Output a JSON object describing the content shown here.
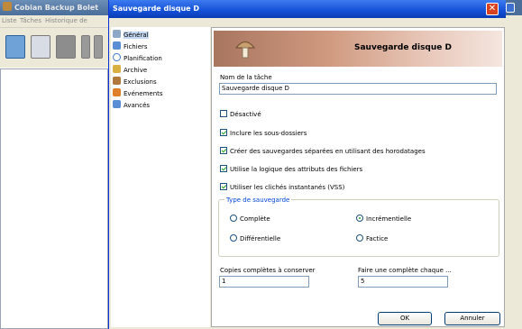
{
  "background_app": {
    "title": "Cobian Backup Bolet",
    "menu": [
      "Liste",
      "Tâches",
      "Historique de"
    ],
    "toolbar_icons": [
      "open-folder-icon",
      "save-icon",
      "delete-icon",
      "tool-icon"
    ]
  },
  "dialog": {
    "title": "Sauvegarde disque D",
    "close_glyph": "✕",
    "header_title": "Sauvegarde disque D",
    "nav": [
      {
        "label": "Général",
        "icon": "general-icon",
        "color": "#8fa8c8",
        "selected": true
      },
      {
        "label": "Fichiers",
        "icon": "files-icon",
        "color": "#5a8fd6",
        "selected": false
      },
      {
        "label": "Planification",
        "icon": "schedule-icon",
        "color": "#3d7bd1",
        "selected": false
      },
      {
        "label": "Archive",
        "icon": "archive-icon",
        "color": "#d8b040",
        "selected": false
      },
      {
        "label": "Exclusions",
        "icon": "exclusions-icon",
        "color": "#b07a3c",
        "selected": false
      },
      {
        "label": "Evénements",
        "icon": "events-icon",
        "color": "#e0802a",
        "selected": false
      },
      {
        "label": "Avancés",
        "icon": "advanced-icon",
        "color": "#5a8fd6",
        "selected": false
      }
    ],
    "task_name_label": "Nom de la tâche",
    "task_name_value": "Sauvegarde disque D",
    "options": [
      {
        "label": "Désactivé",
        "checked": false
      },
      {
        "label": "Inclure les sous-dossiers",
        "checked": true
      },
      {
        "label": "Créer des sauvegardes séparées en utilisant des horodatages",
        "checked": true
      },
      {
        "label": "Utilise la logique des attributs des fichiers",
        "checked": true
      },
      {
        "label": "Utiliser les clichés instantanés (VSS)",
        "checked": true
      }
    ],
    "backup_type": {
      "title": "Type de sauvegarde",
      "options": [
        {
          "label": "Complète",
          "selected": false
        },
        {
          "label": "Incrémentielle",
          "selected": true
        },
        {
          "label": "Différentielle",
          "selected": false
        },
        {
          "label": "Factice",
          "selected": false
        }
      ]
    },
    "full_copies_label": "Copies complètes à conserver",
    "full_copies_value": "1",
    "full_every_label": "Faire une complète chaque ...",
    "full_every_value": "5",
    "ok_label": "OK",
    "cancel_label": "Annuler"
  }
}
